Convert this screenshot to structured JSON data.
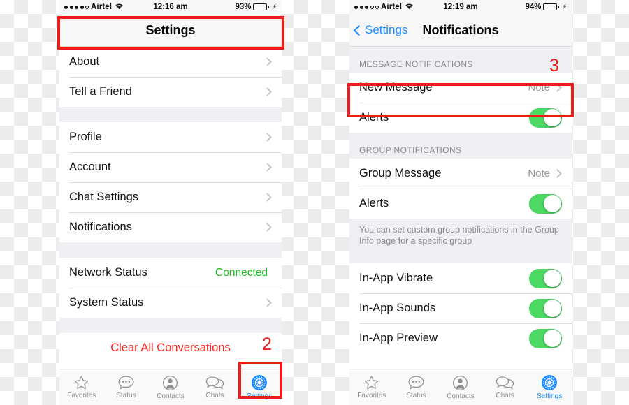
{
  "left_phone": {
    "status_bar": {
      "signal_dots_filled": 4,
      "signal_dots_total": 5,
      "carrier": "Airtel",
      "wifi_icon": "wifi-icon",
      "time": "12:16 am",
      "battery_percent": "93%",
      "battery_level": 93,
      "charging_icon": "lightning-bolt-icon"
    },
    "navbar": {
      "title": "Settings"
    },
    "groups": [
      {
        "rows": [
          {
            "label": "About",
            "accessory": "chevron"
          },
          {
            "label": "Tell a Friend",
            "accessory": "chevron"
          }
        ]
      },
      {
        "rows": [
          {
            "label": "Profile",
            "accessory": "chevron"
          },
          {
            "label": "Account",
            "accessory": "chevron"
          },
          {
            "label": "Chat Settings",
            "accessory": "chevron"
          },
          {
            "label": "Notifications",
            "accessory": "chevron"
          }
        ]
      },
      {
        "rows": [
          {
            "label": "Network Status",
            "value": "Connected",
            "value_color": "#18c018",
            "accessory": "none"
          },
          {
            "label": "System Status",
            "accessory": "chevron"
          }
        ]
      },
      {
        "rows": [
          {
            "label": "Clear All Conversations",
            "accessory": "none",
            "destructive": true
          }
        ]
      }
    ],
    "tabbar": [
      {
        "icon": "star-icon",
        "label": "Favorites",
        "active": false
      },
      {
        "icon": "status-bubble-icon",
        "label": "Status",
        "active": false
      },
      {
        "icon": "contact-person-icon",
        "label": "Contacts",
        "active": false
      },
      {
        "icon": "chat-bubbles-icon",
        "label": "Chats",
        "active": false
      },
      {
        "icon": "gear-icon",
        "label": "Settings",
        "active": true
      }
    ]
  },
  "right_phone": {
    "status_bar": {
      "signal_dots_filled": 3,
      "signal_dots_total": 5,
      "carrier": "Airtel",
      "wifi_icon": "wifi-icon",
      "time": "12:19 am",
      "battery_percent": "94%",
      "battery_level": 94,
      "charging_icon": "lightning-bolt-icon"
    },
    "navbar": {
      "back_label": "Settings",
      "title": "Notifications"
    },
    "sections": [
      {
        "header": "MESSAGE NOTIFICATIONS",
        "rows": [
          {
            "label": "New Message",
            "value": "Note",
            "accessory": "chevron"
          },
          {
            "label": "Alerts",
            "accessory": "toggle",
            "toggle_on": true
          }
        ]
      },
      {
        "header": "GROUP NOTIFICATIONS",
        "rows": [
          {
            "label": "Group Message",
            "value": "Note",
            "accessory": "chevron"
          },
          {
            "label": "Alerts",
            "accessory": "toggle",
            "toggle_on": true
          }
        ],
        "footnote": "You can set custom group notifications in the Group Info page for a specific group"
      },
      {
        "header": "",
        "rows": [
          {
            "label": "In-App Vibrate",
            "accessory": "toggle",
            "toggle_on": true
          },
          {
            "label": "In-App Sounds",
            "accessory": "toggle",
            "toggle_on": true
          },
          {
            "label": "In-App Preview",
            "accessory": "toggle",
            "toggle_on": true
          }
        ]
      }
    ],
    "tabbar": [
      {
        "icon": "star-icon",
        "label": "Favorites",
        "active": false
      },
      {
        "icon": "status-bubble-icon",
        "label": "Status",
        "active": false
      },
      {
        "icon": "contact-person-icon",
        "label": "Contacts",
        "active": false
      },
      {
        "icon": "chat-bubbles-icon",
        "label": "Chats",
        "active": false
      },
      {
        "icon": "gear-icon",
        "label": "Settings",
        "active": true
      }
    ]
  },
  "annotations": {
    "color": "#ee1b16",
    "step_2": "2",
    "step_3": "3"
  }
}
